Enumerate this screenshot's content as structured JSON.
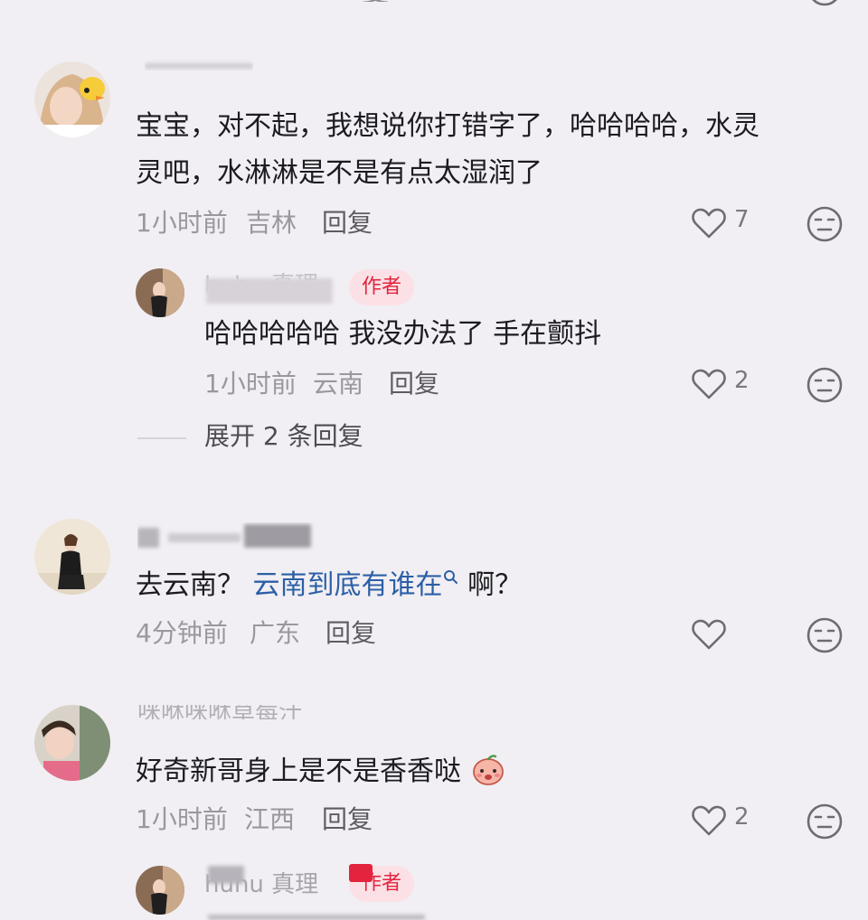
{
  "colors": {
    "background": "#f1eff3",
    "author_tag_text": "#e4243e",
    "author_tag_bg": "#fbe1e6",
    "link": "#2c5fa6",
    "meta": "#9a979d"
  },
  "top_partial": {
    "text_fragment": "复"
  },
  "comment1": {
    "user": "",
    "text_line1": "宝宝，对不起，我想说你打错字了，哈哈哈哈，水灵",
    "text_line2": "灵吧，水淋淋是不是有点太湿润了",
    "time": "1小时前",
    "location": "吉林",
    "reply_label": "回复",
    "likes": "7"
  },
  "reply1": {
    "user": "huhu 真理",
    "author_tag": "作者",
    "text": "哈哈哈哈哈 我没办法了 手在颤抖",
    "time": "1小时前",
    "location": "云南",
    "reply_label": "回复",
    "likes": "2"
  },
  "expand_replies": "展开 2 条回复",
  "comment2": {
    "user": "",
    "text_before": "去云南？",
    "link_text": "云南到底有谁在",
    "text_after": "啊？",
    "time": "4分钟前",
    "location": "广东",
    "reply_label": "回复"
  },
  "comment3": {
    "user": "咪咻咪咻草莓汁",
    "text": "好奇新哥身上是不是香香哒",
    "emoji": "peach-shy-emoji",
    "time": "1小时前",
    "location": "江西",
    "reply_label": "回复",
    "likes": "2"
  },
  "reply2": {
    "user": "huhu 真理",
    "author_tag": "作者"
  },
  "icons": {
    "like": "heart-outline-icon",
    "dislike": "unamused-face-icon",
    "search": "search-icon"
  }
}
